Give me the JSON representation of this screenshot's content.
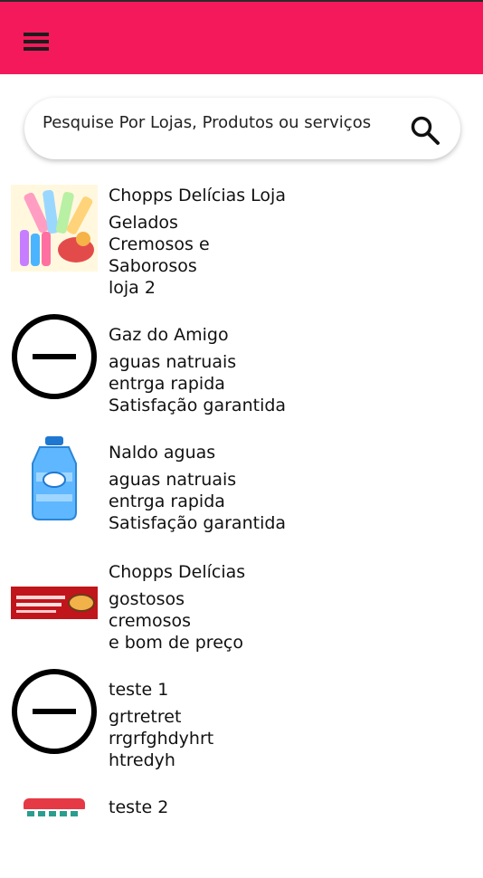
{
  "search": {
    "placeholder": "Pesquise Por Lojas, Produtos ou serviços"
  },
  "stores": [
    {
      "name": "Chopps Delícias Loja",
      "lines": [
        "Gelados",
        "Cremosos e",
        "Saborosos",
        "loja 2"
      ],
      "icon": "popsicle-image"
    },
    {
      "name": "Gaz do Amigo",
      "lines": [
        "aguas natruais",
        "entrga rapida",
        "Satisfação garantida"
      ],
      "icon": "minus-circle-icon"
    },
    {
      "name": "Naldo aguas",
      "lines": [
        "aguas natruais",
        "entrga rapida",
        "Satisfação garantida"
      ],
      "icon": "water-gallon-image"
    },
    {
      "name": "Chopps Delícias",
      "lines": [
        "gostosos",
        "cremosos",
        "e bom de preço"
      ],
      "icon": "restaurant-banner-image"
    },
    {
      "name": "teste 1",
      "lines": [
        "grtretret",
        "rrgrfghdyhrt",
        "htredyh"
      ],
      "icon": "minus-circle-icon"
    },
    {
      "name": "teste 2",
      "lines": [],
      "icon": "store-image"
    }
  ],
  "colors": {
    "appbar": "#f4195a",
    "text": "#111111"
  }
}
